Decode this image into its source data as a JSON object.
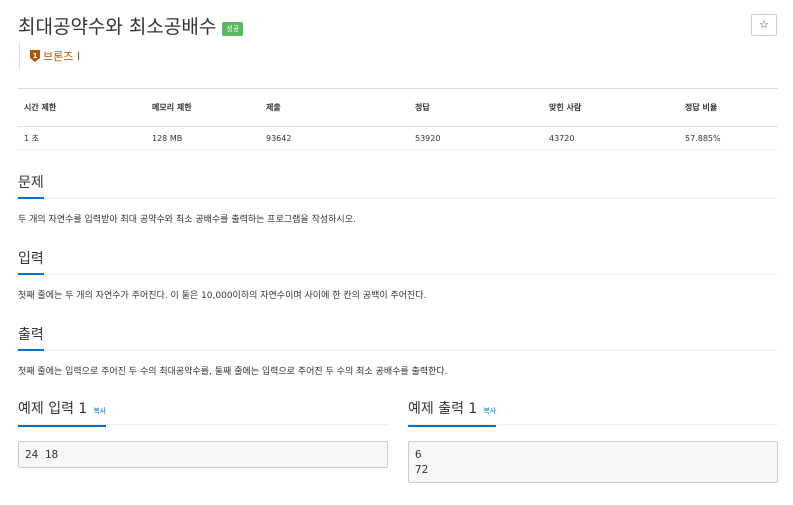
{
  "problem": {
    "title": "최대공약수와 최소공배수",
    "status_badge": "성공",
    "tier_icon_number": "1",
    "tier_label": "브론즈 I",
    "star_label": "☆"
  },
  "stats": {
    "headers": [
      "시간 제한",
      "메모리 제한",
      "제출",
      "정답",
      "맞힌 사람",
      "정답 비율"
    ],
    "values": [
      "1 초",
      "128 MB",
      "93642",
      "53920",
      "43720",
      "57.885%"
    ]
  },
  "sections": {
    "description": {
      "title": "문제",
      "text": "두 개의 자연수를 입력받아 최대 공약수와 최소 공배수를 출력하는 프로그램을 작성하시오."
    },
    "input": {
      "title": "입력",
      "text": "첫째 줄에는 두 개의 자연수가 주어진다. 이 둘은 10,000이하의 자연수이며 사이에 한 칸의 공백이 주어진다."
    },
    "output": {
      "title": "출력",
      "text": "첫째 줄에는 입력으로 주어진 두 수의 최대공약수를, 둘째 줄에는 입력으로 주어진 두 수의 최소 공배수를 출력한다."
    }
  },
  "examples": {
    "input": {
      "title": "예제 입력 1",
      "copy_label": "복사",
      "content": "24 18"
    },
    "output": {
      "title": "예제 출력 1",
      "copy_label": "복사",
      "content": "6\n72"
    }
  },
  "colors": {
    "success": "#5cb85c",
    "bronze": "#ad5600",
    "accent": "#0076c0"
  }
}
